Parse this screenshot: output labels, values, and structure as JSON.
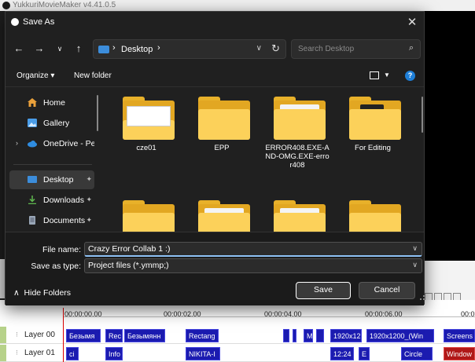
{
  "app": {
    "title": "YukkuriMovieMaker v4.41.0.5"
  },
  "dialog": {
    "title": "Save As",
    "close_icon": "close-icon",
    "address": {
      "location": "Desktop",
      "separator": "›"
    },
    "search": {
      "placeholder": "Search Desktop"
    },
    "toolbar": {
      "organize": "Organize ▾",
      "new_folder": "New folder",
      "help": "?"
    },
    "sidebar": {
      "items": [
        {
          "label": "Home",
          "icon": "home-icon"
        },
        {
          "label": "Gallery",
          "icon": "gallery-icon"
        },
        {
          "label": "OneDrive - Perso",
          "icon": "cloud-icon"
        },
        {
          "label": "Desktop",
          "icon": "desktop-icon"
        },
        {
          "label": "Downloads",
          "icon": "download-icon"
        },
        {
          "label": "Documents",
          "icon": "documents-icon"
        }
      ]
    },
    "files": [
      {
        "name": "cze01"
      },
      {
        "name": "EPP"
      },
      {
        "name": "ERROR408.EXE-AND-OMG.EXE-error408"
      },
      {
        "name": "For Editing"
      },
      {
        "name": ""
      },
      {
        "name": ""
      },
      {
        "name": ""
      },
      {
        "name": ""
      }
    ],
    "form": {
      "file_name_label": "File name:",
      "file_name_value": "Crazy Error Collab 1 :)",
      "save_type_label": "Save as type:",
      "save_type_value": "Project files (*.ymmp;)"
    },
    "hide_folders": "Hide Folders",
    "save_label": "Save",
    "cancel_label": "Cancel"
  },
  "timeline": {
    "ruler": [
      "00:00:00.00",
      "00:00:02.00",
      "00:00:04.00",
      "00:00:06.00",
      "00:0"
    ],
    "tracks": [
      {
        "name": "Layer 00",
        "clips": [
          "Безымя",
          "Rec",
          "Безымянн",
          "Rectang",
          "",
          "",
          "M",
          "",
          "1920x12",
          "1920x1200_(Win",
          "Screens"
        ]
      },
      {
        "name": "Layer 01",
        "clips": [
          "ci",
          "Info",
          "NIKITA-I",
          "12:24",
          "E",
          "Circle",
          "Window"
        ]
      }
    ]
  }
}
